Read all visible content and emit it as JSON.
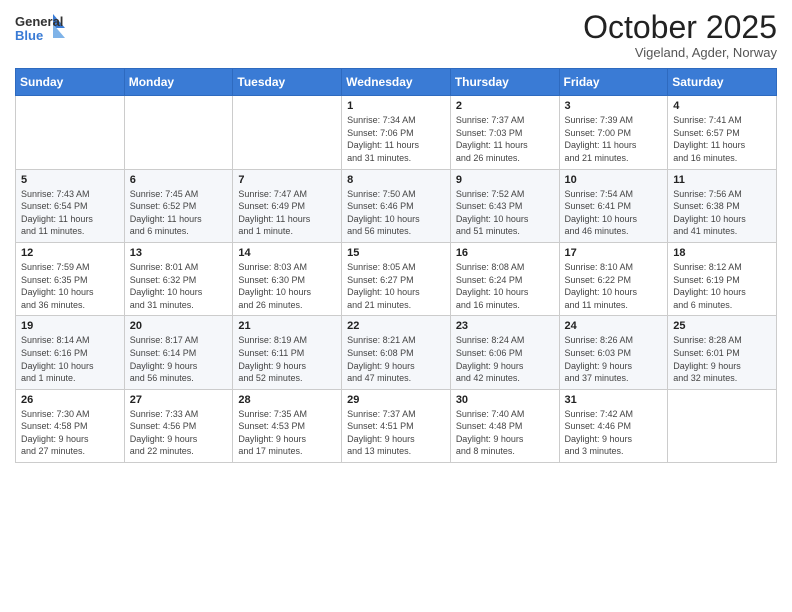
{
  "header": {
    "logo_general": "General",
    "logo_blue": "Blue",
    "month_title": "October 2025",
    "location": "Vigeland, Agder, Norway"
  },
  "weekdays": [
    "Sunday",
    "Monday",
    "Tuesday",
    "Wednesday",
    "Thursday",
    "Friday",
    "Saturday"
  ],
  "weeks": [
    [
      {
        "day": "",
        "info": ""
      },
      {
        "day": "",
        "info": ""
      },
      {
        "day": "",
        "info": ""
      },
      {
        "day": "1",
        "info": "Sunrise: 7:34 AM\nSunset: 7:06 PM\nDaylight: 11 hours\nand 31 minutes."
      },
      {
        "day": "2",
        "info": "Sunrise: 7:37 AM\nSunset: 7:03 PM\nDaylight: 11 hours\nand 26 minutes."
      },
      {
        "day": "3",
        "info": "Sunrise: 7:39 AM\nSunset: 7:00 PM\nDaylight: 11 hours\nand 21 minutes."
      },
      {
        "day": "4",
        "info": "Sunrise: 7:41 AM\nSunset: 6:57 PM\nDaylight: 11 hours\nand 16 minutes."
      }
    ],
    [
      {
        "day": "5",
        "info": "Sunrise: 7:43 AM\nSunset: 6:54 PM\nDaylight: 11 hours\nand 11 minutes."
      },
      {
        "day": "6",
        "info": "Sunrise: 7:45 AM\nSunset: 6:52 PM\nDaylight: 11 hours\nand 6 minutes."
      },
      {
        "day": "7",
        "info": "Sunrise: 7:47 AM\nSunset: 6:49 PM\nDaylight: 11 hours\nand 1 minute."
      },
      {
        "day": "8",
        "info": "Sunrise: 7:50 AM\nSunset: 6:46 PM\nDaylight: 10 hours\nand 56 minutes."
      },
      {
        "day": "9",
        "info": "Sunrise: 7:52 AM\nSunset: 6:43 PM\nDaylight: 10 hours\nand 51 minutes."
      },
      {
        "day": "10",
        "info": "Sunrise: 7:54 AM\nSunset: 6:41 PM\nDaylight: 10 hours\nand 46 minutes."
      },
      {
        "day": "11",
        "info": "Sunrise: 7:56 AM\nSunset: 6:38 PM\nDaylight: 10 hours\nand 41 minutes."
      }
    ],
    [
      {
        "day": "12",
        "info": "Sunrise: 7:59 AM\nSunset: 6:35 PM\nDaylight: 10 hours\nand 36 minutes."
      },
      {
        "day": "13",
        "info": "Sunrise: 8:01 AM\nSunset: 6:32 PM\nDaylight: 10 hours\nand 31 minutes."
      },
      {
        "day": "14",
        "info": "Sunrise: 8:03 AM\nSunset: 6:30 PM\nDaylight: 10 hours\nand 26 minutes."
      },
      {
        "day": "15",
        "info": "Sunrise: 8:05 AM\nSunset: 6:27 PM\nDaylight: 10 hours\nand 21 minutes."
      },
      {
        "day": "16",
        "info": "Sunrise: 8:08 AM\nSunset: 6:24 PM\nDaylight: 10 hours\nand 16 minutes."
      },
      {
        "day": "17",
        "info": "Sunrise: 8:10 AM\nSunset: 6:22 PM\nDaylight: 10 hours\nand 11 minutes."
      },
      {
        "day": "18",
        "info": "Sunrise: 8:12 AM\nSunset: 6:19 PM\nDaylight: 10 hours\nand 6 minutes."
      }
    ],
    [
      {
        "day": "19",
        "info": "Sunrise: 8:14 AM\nSunset: 6:16 PM\nDaylight: 10 hours\nand 1 minute."
      },
      {
        "day": "20",
        "info": "Sunrise: 8:17 AM\nSunset: 6:14 PM\nDaylight: 9 hours\nand 56 minutes."
      },
      {
        "day": "21",
        "info": "Sunrise: 8:19 AM\nSunset: 6:11 PM\nDaylight: 9 hours\nand 52 minutes."
      },
      {
        "day": "22",
        "info": "Sunrise: 8:21 AM\nSunset: 6:08 PM\nDaylight: 9 hours\nand 47 minutes."
      },
      {
        "day": "23",
        "info": "Sunrise: 8:24 AM\nSunset: 6:06 PM\nDaylight: 9 hours\nand 42 minutes."
      },
      {
        "day": "24",
        "info": "Sunrise: 8:26 AM\nSunset: 6:03 PM\nDaylight: 9 hours\nand 37 minutes."
      },
      {
        "day": "25",
        "info": "Sunrise: 8:28 AM\nSunset: 6:01 PM\nDaylight: 9 hours\nand 32 minutes."
      }
    ],
    [
      {
        "day": "26",
        "info": "Sunrise: 7:30 AM\nSunset: 4:58 PM\nDaylight: 9 hours\nand 27 minutes."
      },
      {
        "day": "27",
        "info": "Sunrise: 7:33 AM\nSunset: 4:56 PM\nDaylight: 9 hours\nand 22 minutes."
      },
      {
        "day": "28",
        "info": "Sunrise: 7:35 AM\nSunset: 4:53 PM\nDaylight: 9 hours\nand 17 minutes."
      },
      {
        "day": "29",
        "info": "Sunrise: 7:37 AM\nSunset: 4:51 PM\nDaylight: 9 hours\nand 13 minutes."
      },
      {
        "day": "30",
        "info": "Sunrise: 7:40 AM\nSunset: 4:48 PM\nDaylight: 9 hours\nand 8 minutes."
      },
      {
        "day": "31",
        "info": "Sunrise: 7:42 AM\nSunset: 4:46 PM\nDaylight: 9 hours\nand 3 minutes."
      },
      {
        "day": "",
        "info": ""
      }
    ]
  ]
}
